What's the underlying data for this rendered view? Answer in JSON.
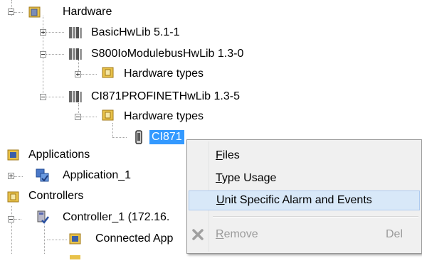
{
  "tree": {
    "hardware": "Hardware",
    "basic_hwlib": "BasicHwLib 5.1-1",
    "s800_hwlib": "S800IoModulebusHwLib 1.3-0",
    "hardware_types_1": "Hardware types",
    "ci871_hwlib": "CI871PROFINETHwLib 1.3-5",
    "hardware_types_2": "Hardware types",
    "ci871": "CI871",
    "applications": "Applications",
    "application_1": "Application_1",
    "controllers": "Controllers",
    "controller_1": "Controller_1 (172.16.",
    "connected_apps": "Connected App"
  },
  "context_menu": {
    "files": {
      "mnemonic": "F",
      "rest": "iles"
    },
    "type_usage": {
      "mnemonic": "T",
      "rest": "ype Usage"
    },
    "unit_alarm": {
      "mnemonic": "U",
      "rest": "nit Specific Alarm and Events"
    },
    "remove": {
      "mnemonic": "R",
      "rest": "emove",
      "shortcut": "Del"
    }
  },
  "colors": {
    "selection": "#3399ff",
    "menu_highlight": "#d8e8f8",
    "disabled_text": "#9b9b9b"
  },
  "icons": [
    "library-icon",
    "folder-icon",
    "hardware-unit-icon",
    "application-icon",
    "controller-icon",
    "remove-icon"
  ]
}
